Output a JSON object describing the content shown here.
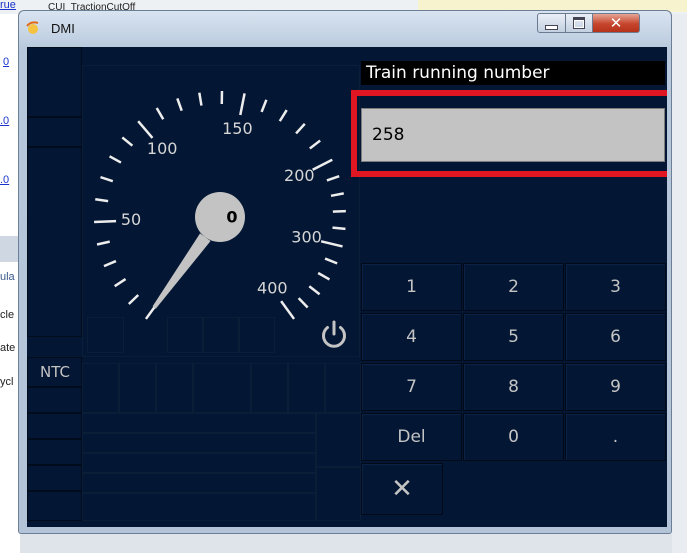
{
  "background": {
    "app_texts": [
      {
        "text": "rue",
        "style": "link"
      },
      {
        "text": "CUI_TractionCutOff",
        "style": "dark"
      },
      {
        "text": "0",
        "style": "link"
      },
      {
        "text": ".0",
        "style": "link"
      },
      {
        "text": ".0",
        "style": "link"
      },
      {
        "text": "ula",
        "style": "dark"
      },
      {
        "text": "cle",
        "style": "dark"
      },
      {
        "text": "ate",
        "style": "dark"
      },
      {
        "text": "ycl",
        "style": "dark"
      }
    ]
  },
  "window": {
    "title": "DMI",
    "controls": {
      "minimize": "minimize",
      "maximize": "maximize",
      "close": "✕"
    }
  },
  "speedometer": {
    "max_speed": 400,
    "current_speed": 0,
    "current_speed_label": "0",
    "scale_labels": [
      "50",
      "100",
      "150",
      "200",
      "300",
      "400"
    ]
  },
  "ntc": {
    "label": "NTC"
  },
  "data_entry": {
    "label": "Train running number",
    "value": "258",
    "highlight_color": "#e01623"
  },
  "keypad": {
    "keys": [
      "1",
      "2",
      "3",
      "4",
      "5",
      "6",
      "7",
      "8",
      "9",
      "Del",
      "0",
      "."
    ],
    "close_symbol": "✕"
  },
  "colors": {
    "dmi_background": "#031633",
    "input_field": "#c3c3c3",
    "text": "#c4c4c4"
  }
}
